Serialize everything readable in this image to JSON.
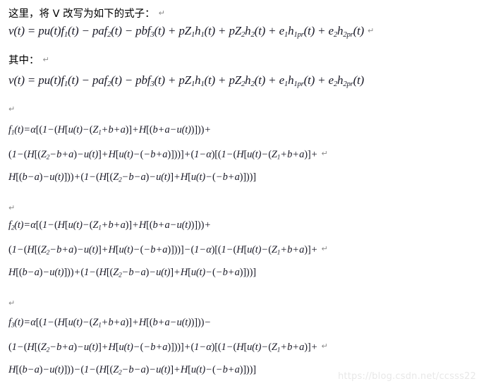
{
  "document": {
    "intro_line": "这里，将 V 改写为如下的式子：",
    "where_line": "其中：",
    "pilcrow_glyph": "↵",
    "watermark": "https://blog.csdn.net/ccsss22"
  },
  "equations": {
    "v_main": "v(t) = pu(t)f₁(t) − paf₂(t) − pbf₃(t) + pZ₁h₁(t) + pZ₂h₂(t) + e₁h₁pr(t) + e₂h₂pr(t)",
    "v_repeat": "v(t) = pu(t)f₁(t) − paf₂(t) − pbf₃(t) + pZ₁h₁(t) + pZ₂h₂(t) + e₁h₁pr(t) + e₂h₂pr(t)",
    "f1": {
      "line1": "f₁(t) = α[(1−(H[u(t)−(Z₁+b+a)]+H[(b+a−u(t))]))+",
      "line2": "(1−(H[(Z₂−b+a)−u(t)]+H[u(t)−(−b+a)]))] + (1−α)[(1−(H[u(t)−(Z₁+b+a)]+",
      "line3": "H[(b−a)−u(t)]))+(1−(H[(Z₂−b−a)−u(t)]+H[u(t)−(−b+a)]))]"
    },
    "f2": {
      "line1": "f₂(t) = α[(1−(H[u(t)−(Z₁+b+a)]+H[(b+a−u(t))]))+",
      "line2": "(1−(H[(Z₂−b+a)−u(t)]+H[u(t)−(−b+a)]))] − (1−α)[(1−(H[u(t)−(Z₁+b+a)]+",
      "line3": "H[(b−a)−u(t)]))+(1−(H[(Z₂−b−a)−u(t)]+H[u(t)−(−b+a)]))]"
    },
    "f3": {
      "line1": "f₃(t) = α[(1−(H[u(t)−(Z₁+b+a)]+H[(b+a−u(t))]))−",
      "line2": "(1−(H[(Z₂−b+a)−u(t)]+H[u(t)−(−b+a)]))] + (1−α)[(1−(H[u(t)−(Z₁+b+a)]+",
      "line3": "H[(b−a)−u(t)]))−(1−(H[(Z₂−b−a)−u(t)]+H[u(t)−(−b+a)]))]"
    }
  },
  "symbols": {
    "v": "v",
    "t": "t",
    "p": "p",
    "u": "u",
    "a": "a",
    "b": "b",
    "e": "e",
    "H": "H",
    "Z": "Z",
    "h": "h",
    "f": "f",
    "alpha": "α",
    "pr": "pr",
    "equals": "=",
    "plus": "+",
    "minus": "−",
    "one": "1"
  }
}
